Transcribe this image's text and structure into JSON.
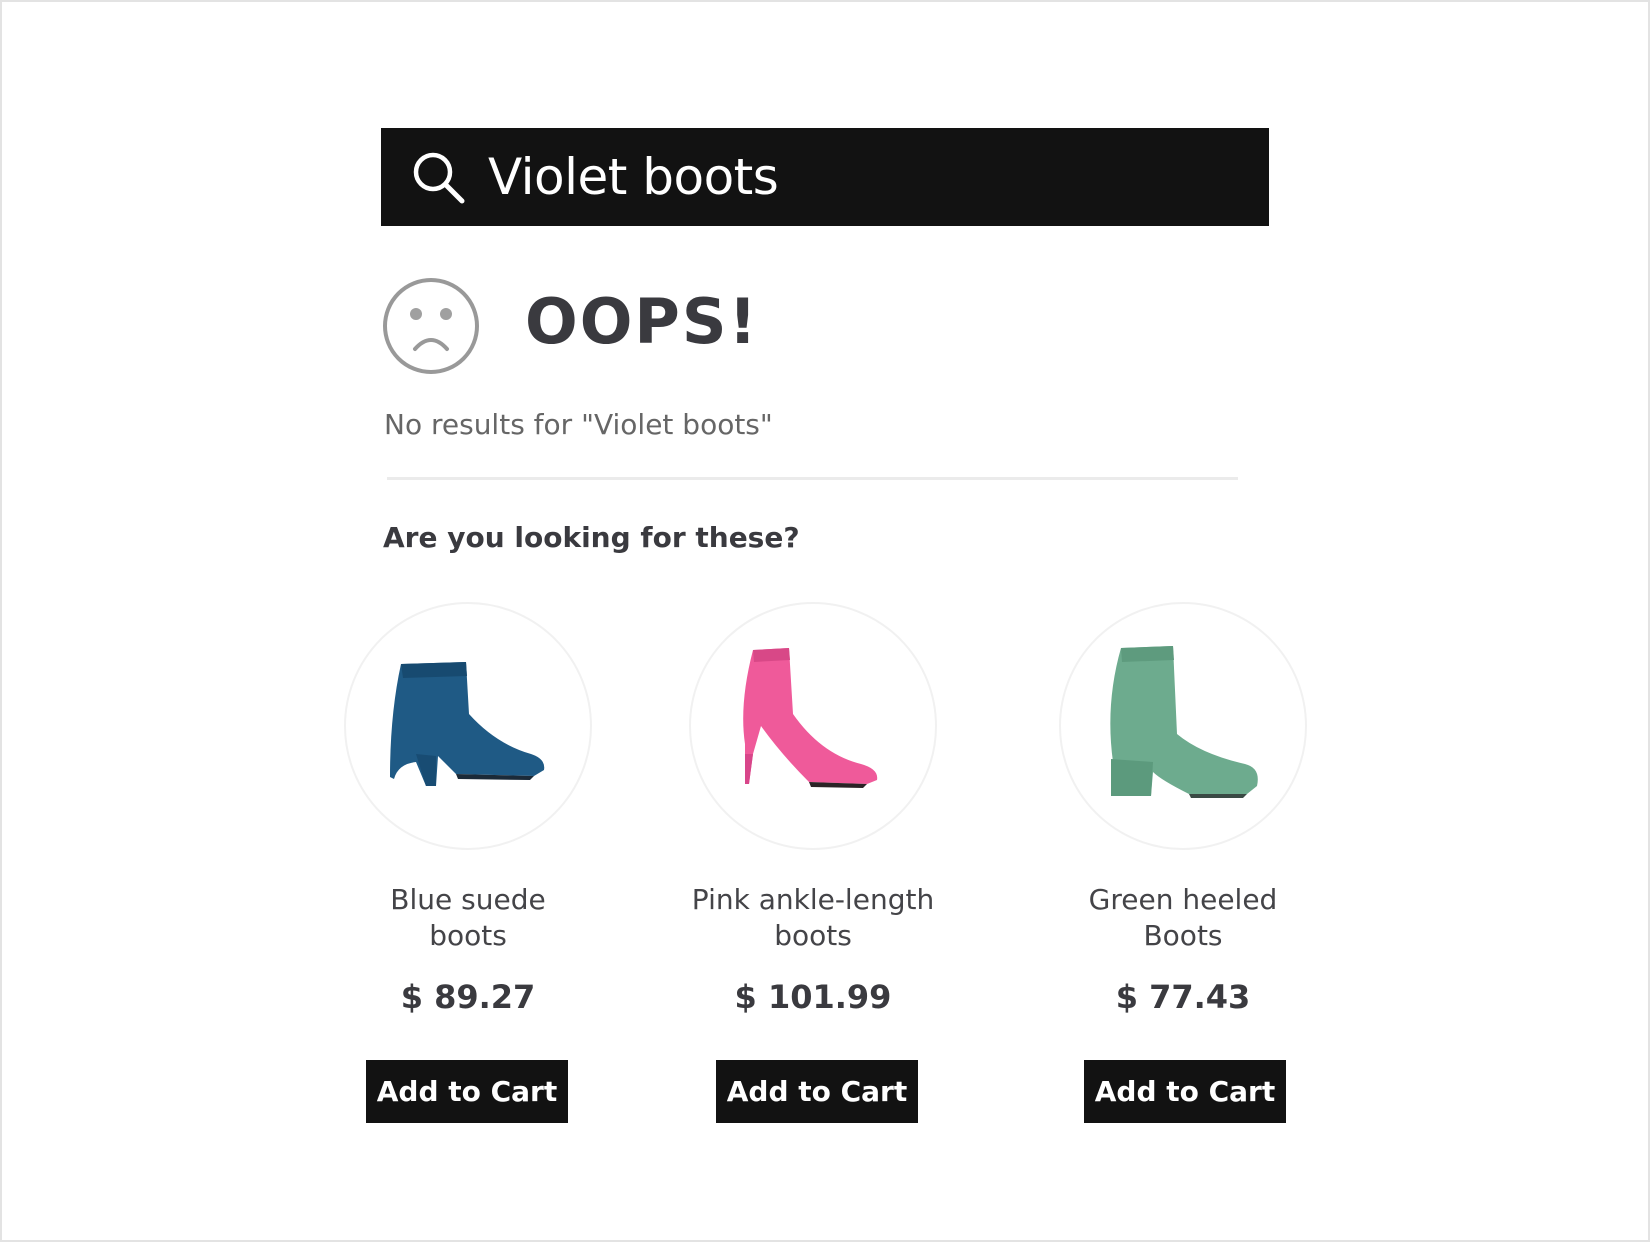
{
  "search": {
    "query": "Violet boots",
    "icon": "search-icon",
    "background": "#121212"
  },
  "empty_state": {
    "icon": "sad-face-icon",
    "title": "OOPS!",
    "message": "No results for \"Violet boots\""
  },
  "suggestions": {
    "heading": "Are you looking for these?",
    "products": [
      {
        "name_line1": "Blue suede",
        "name_line2": "boots",
        "price": "$ 89.27",
        "button_label": "Add to Cart",
        "color": "#1f5a85"
      },
      {
        "name_line1": "Pink ankle-length",
        "name_line2": "boots",
        "price": "$ 101.99",
        "button_label": "Add to Cart",
        "color": "#ef5a9a"
      },
      {
        "name_line1": "Green heeled",
        "name_line2": "Boots",
        "price": "$ 77.43",
        "button_label": "Add to Cart",
        "color": "#6dab8e"
      }
    ]
  }
}
